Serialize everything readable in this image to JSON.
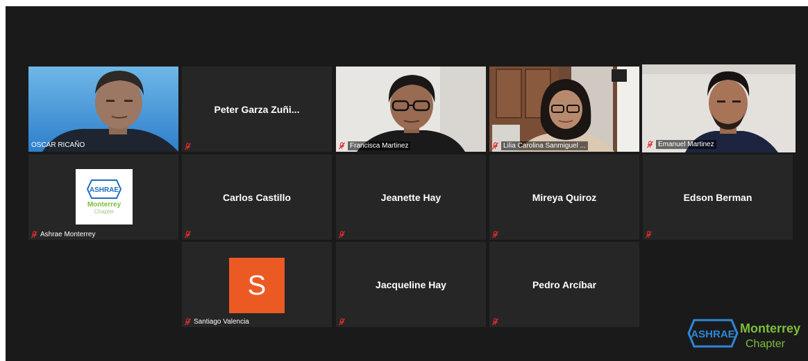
{
  "participants": [
    {
      "name": "OSCAR RICAÑO",
      "type": "video",
      "muted": false
    },
    {
      "name": "Peter Garza Zuñi...",
      "type": "name",
      "muted": true
    },
    {
      "name": "Francisca Martinez",
      "type": "video",
      "muted": true
    },
    {
      "name": "Lilia Carolina Sanmiguel ...",
      "type": "video",
      "muted": true
    },
    {
      "name": "Emanuel Martinez",
      "type": "video",
      "muted": true,
      "active_speaker": true
    },
    {
      "name": "Ashrae Monterrey",
      "type": "logo",
      "muted": true
    },
    {
      "name": "Carlos Castillo",
      "type": "name",
      "muted": true
    },
    {
      "name": "Jeanette Hay",
      "type": "name",
      "muted": true
    },
    {
      "name": "Mireya Quiroz",
      "type": "name",
      "muted": true
    },
    {
      "name": "Edson Berman",
      "type": "name",
      "muted": true
    },
    {
      "name": "Santiago Valencia",
      "type": "avatar",
      "avatar_letter": "S",
      "avatar_color": "#ec5a24",
      "muted": true
    },
    {
      "name": "Jacqueline Hay",
      "type": "name",
      "muted": true
    },
    {
      "name": "Pedro Arcíbar",
      "type": "name",
      "muted": true
    }
  ],
  "logo": {
    "brand": "ASHRAE",
    "chapter_name": "Monterrey",
    "chapter_label": "Chapter"
  },
  "watermark": {
    "brand": "ASHRAE",
    "chapter_name": "Monterrey",
    "chapter_label": "Chapter"
  },
  "colors": {
    "active_speaker_border": "#c6df5c",
    "muted_icon": "#e02b2b",
    "tile_bg": "#262626",
    "window_bg": "#1a1a1a",
    "brand_blue": "#1f6bbf",
    "brand_green": "#7bbf3a"
  }
}
